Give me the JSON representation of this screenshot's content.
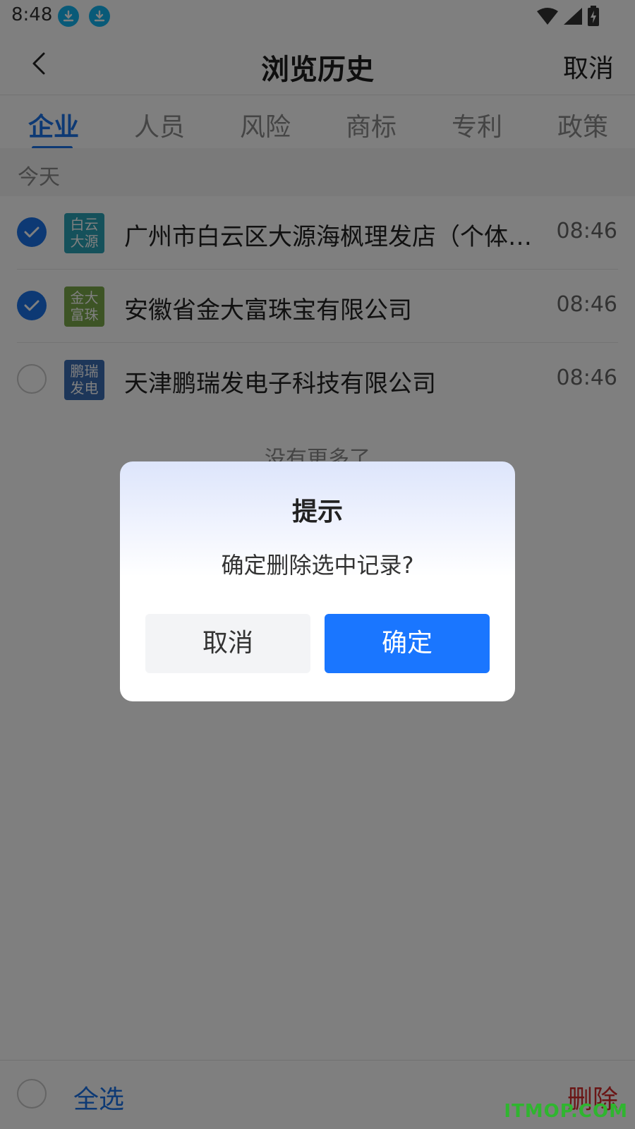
{
  "status_bar": {
    "time": "8:48"
  },
  "header": {
    "title": "浏览历史",
    "cancel_label": "取消"
  },
  "tabs": [
    {
      "label": "企业",
      "active": true
    },
    {
      "label": "人员"
    },
    {
      "label": "风险"
    },
    {
      "label": "商标"
    },
    {
      "label": "专利"
    },
    {
      "label": "政策"
    }
  ],
  "section": {
    "label": "今天"
  },
  "records": [
    {
      "logo_line1": "白云",
      "logo_line2": "大源",
      "logo_color": "#2aa3b6",
      "name": "广州市白云区大源海枫理发店（个体…",
      "time": "08:46",
      "checked": true
    },
    {
      "logo_line1": "金大",
      "logo_line2": "富珠",
      "logo_color": "#7aa84a",
      "name": "安徽省金大富珠宝有限公司",
      "time": "08:46",
      "checked": true
    },
    {
      "logo_line1": "鹏瑞",
      "logo_line2": "发电",
      "logo_color": "#3b6db3",
      "name": "天津鹏瑞发电子科技有限公司",
      "time": "08:46",
      "checked": false
    }
  ],
  "list_footer": "没有更多了",
  "bottom_bar": {
    "select_all_label": "全选",
    "delete_label": "删除"
  },
  "dialog": {
    "title": "提示",
    "message": "确定删除选中记录?",
    "cancel_label": "取消",
    "confirm_label": "确定"
  },
  "watermark": "ITMOP.COM",
  "colors": {
    "accent": "#1a73e8",
    "confirm": "#1a76ff",
    "danger": "#d42a2a"
  }
}
